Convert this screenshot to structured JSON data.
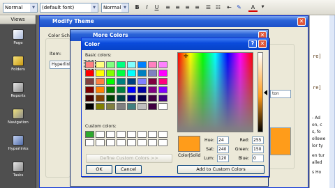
{
  "toolbar": {
    "style": "Normal",
    "font": "(default font)",
    "size": "Normal",
    "buttons": [
      "B",
      "I",
      "U",
      "≡",
      "≡",
      "≡",
      "≡",
      "A"
    ]
  },
  "views": {
    "title": "Views",
    "items": [
      {
        "label": "Page",
        "icon": "page-view-icon"
      },
      {
        "label": "Folders",
        "icon": "folders-view-icon"
      },
      {
        "label": "Reports",
        "icon": "reports-view-icon"
      },
      {
        "label": "Navigation",
        "icon": "navigation-view-icon"
      },
      {
        "label": "Hyperlinks",
        "icon": "hyperlinks-view-icon"
      },
      {
        "label": "Tasks",
        "icon": "tasks-view-icon"
      }
    ]
  },
  "editor": {
    "code_lines": [
      "re]",
      "re]",
      "ton"
    ],
    "right_text": [
      "- Ad",
      "on, c",
      "s, fo",
      "ollowe",
      "lor ty",
      "en tur",
      "alled",
      "s Ho"
    ]
  },
  "modify_theme": {
    "title": "Modify Theme",
    "color_scheme_label": "Color Sche",
    "item_label": "Item:",
    "item_value": "Hyperlink"
  },
  "more_colors": {
    "title": "More Colors"
  },
  "color_dialog": {
    "title": "Color",
    "basic_colors_label": "Basic colors:",
    "custom_colors_label": "Custom colors:",
    "define_button": "Define Custom Colors >>",
    "ok_button": "OK",
    "cancel_button": "Cancel",
    "add_button": "Add to Custom Colors",
    "color_solid_label": "Color|Solid",
    "hue_label": "Hue:",
    "hue_value": "24",
    "sat_label": "Sat:",
    "sat_value": "240",
    "lum_label": "Lum:",
    "lum_value": "120",
    "red_label": "Red:",
    "red_value": "255",
    "green_label": "Green:",
    "green_value": "150",
    "blue_label": "Blue:",
    "blue_value": "0",
    "selected_color": "#ff9c1a",
    "basic_colors": [
      "#ff8080",
      "#ffff80",
      "#80ff80",
      "#00ff80",
      "#80ffff",
      "#0080ff",
      "#ff80c0",
      "#ff80ff",
      "#ff0000",
      "#ffff00",
      "#80ff00",
      "#00ff40",
      "#00ffff",
      "#0080c0",
      "#8080c0",
      "#ff00ff",
      "#804040",
      "#ff8040",
      "#00ff00",
      "#008080",
      "#004080",
      "#8080ff",
      "#800040",
      "#ff0080",
      "#800000",
      "#ff8000",
      "#008000",
      "#008040",
      "#0000ff",
      "#0000a0",
      "#800080",
      "#8000ff",
      "#400000",
      "#804000",
      "#004000",
      "#004040",
      "#000080",
      "#000040",
      "#400040",
      "#400080",
      "#000000",
      "#808000",
      "#808040",
      "#808080",
      "#408080",
      "#c0c0c0",
      "#400040",
      "#ffffff"
    ],
    "custom_colors": [
      "#2ea82e",
      "#ffffff",
      "#ffffff",
      "#ffffff",
      "#ffffff",
      "#ffffff",
      "#ffffff",
      "#ffffff",
      "#ffffff",
      "#ffffff",
      "#ffffff",
      "#ffffff",
      "#ffffff",
      "#ffffff",
      "#ffffff",
      "#ffffff"
    ]
  }
}
